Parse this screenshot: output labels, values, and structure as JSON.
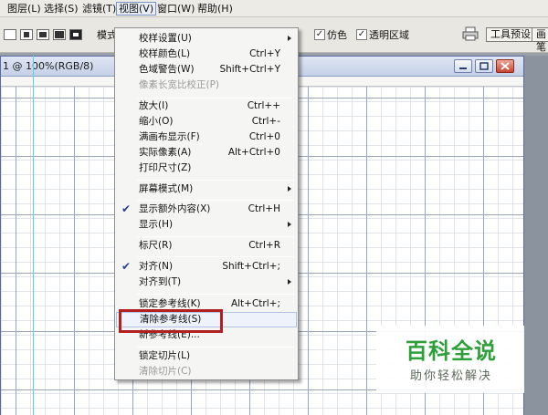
{
  "menubar": {
    "items": [
      {
        "label": "图层(L)"
      },
      {
        "label": "选择(S)"
      },
      {
        "label": "滤镜(T)"
      },
      {
        "label": "视图(V)"
      },
      {
        "label": "窗口(W)"
      },
      {
        "label": "帮助(H)"
      }
    ]
  },
  "options_bar": {
    "mode_label": "模式",
    "antialias": {
      "label": "仿色",
      "checked": true
    },
    "transparency": {
      "label": "透明区域",
      "checked": true
    },
    "tool_presets_label": "工具预设",
    "brushes_label": "画笔"
  },
  "document": {
    "title": "1 @ 100%(RGB/8)"
  },
  "view_menu": {
    "items": [
      {
        "label": "校样设置(U)",
        "shortcut": "",
        "submenu": true
      },
      {
        "label": "校样颜色(L)",
        "shortcut": "Ctrl+Y"
      },
      {
        "label": "色域警告(W)",
        "shortcut": "Shift+Ctrl+Y"
      },
      {
        "label": "像素长宽比校正(P)",
        "shortcut": "",
        "disabled": true
      },
      {
        "label": "放大(I)",
        "shortcut": "Ctrl++"
      },
      {
        "label": "缩小(O)",
        "shortcut": "Ctrl+-"
      },
      {
        "label": "满画布显示(F)",
        "shortcut": "Ctrl+0"
      },
      {
        "label": "实际像素(A)",
        "shortcut": "Alt+Ctrl+0"
      },
      {
        "label": "打印尺寸(Z)",
        "shortcut": ""
      },
      {
        "label": "屏幕模式(M)",
        "shortcut": "",
        "submenu": true
      },
      {
        "label": "显示额外内容(X)",
        "shortcut": "Ctrl+H",
        "checked": true
      },
      {
        "label": "显示(H)",
        "shortcut": "",
        "submenu": true
      },
      {
        "label": "标尺(R)",
        "shortcut": "Ctrl+R"
      },
      {
        "label": "对齐(N)",
        "shortcut": "Shift+Ctrl+;",
        "checked": true
      },
      {
        "label": "对齐到(T)",
        "shortcut": "",
        "submenu": true
      },
      {
        "label": "锁定参考线(K)",
        "shortcut": "Alt+Ctrl+;"
      },
      {
        "label": "清除参考线(S)",
        "shortcut": "",
        "highlighted": true
      },
      {
        "label": "新参考线(E)...",
        "shortcut": ""
      },
      {
        "label": "锁定切片(L)",
        "shortcut": ""
      },
      {
        "label": "清除切片(C)",
        "shortcut": "",
        "disabled": true
      }
    ]
  },
  "watermark": {
    "title": "百科全说",
    "subtitle": "助你轻松解决"
  }
}
